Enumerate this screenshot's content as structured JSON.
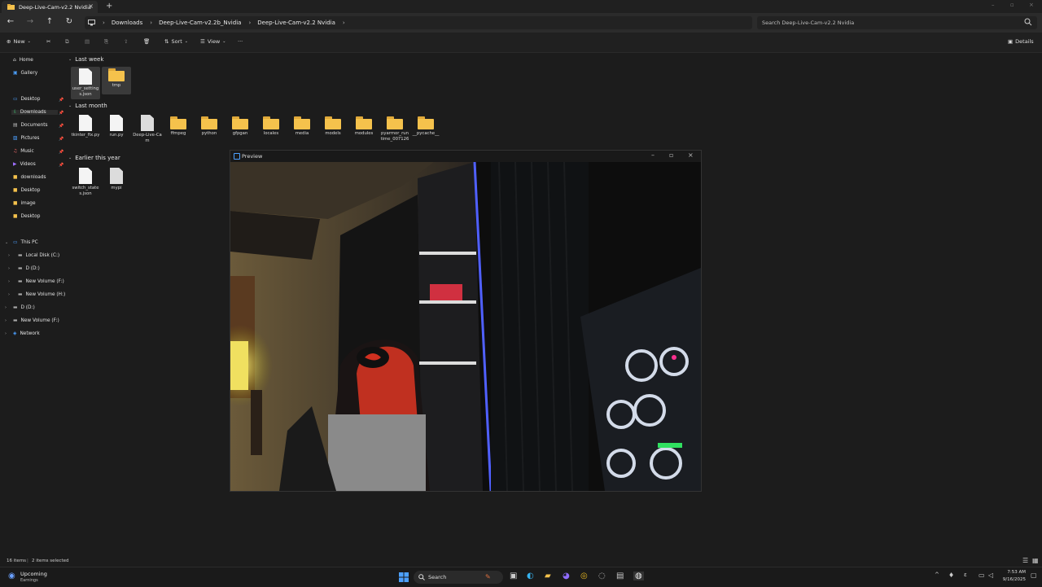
{
  "tab": {
    "title": "Deep-Live-Cam-v2.2 Nvidia"
  },
  "address": {
    "crumbs": [
      "Downloads",
      "Deep-Live-Cam-v2.2b_Nvidia",
      "Deep-Live-Cam-v2.2 Nvidia"
    ]
  },
  "search": {
    "placeholder": "Search Deep-Live-Cam-v2.2 Nvidia"
  },
  "toolbar": {
    "new": "New",
    "sort": "Sort",
    "view": "View",
    "more": "···",
    "details": "Details"
  },
  "sidebar": {
    "home": "Home",
    "gallery": "Gallery",
    "quick": [
      "Desktop",
      "Downloads",
      "Documents",
      "Pictures",
      "Music",
      "Videos",
      "downloads",
      "Desktop",
      "image",
      "Desktop"
    ],
    "this_pc": "This PC",
    "drives": [
      "Local Disk (C:)",
      "D (D:)",
      "New Volume (F:)",
      "New Volume (H:)"
    ],
    "extra": [
      "D (D:)",
      "New Volume (F:)"
    ],
    "network": "Network"
  },
  "groups": {
    "last_week": "Last week",
    "last_month": "Last month",
    "earlier": "Earlier this year"
  },
  "files": {
    "last_week": [
      "user_settings.json",
      "tmp"
    ],
    "last_month": [
      "tkinter_fix.py",
      "run.py",
      "Deep-Live-Cam",
      "ffmpeg",
      "python",
      "gfpgan",
      "locales",
      "media",
      "models",
      "modules",
      "pyarmor_runtime_007126",
      "__pycache__"
    ],
    "earlier": [
      "switch_states.json",
      "mypi"
    ]
  },
  "preview": {
    "title": "Preview"
  },
  "status": {
    "items": "16 items",
    "selected": "2 items selected"
  },
  "taskbar": {
    "weather_title": "Upcoming",
    "weather_sub": "Earnings",
    "search": "Search",
    "time": "7:53 AM",
    "date": "9/16/2025"
  }
}
